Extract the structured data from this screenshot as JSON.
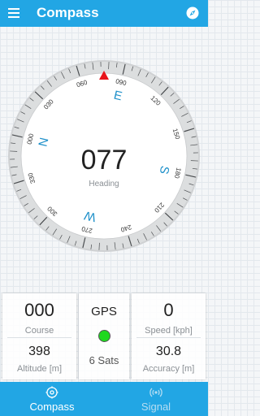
{
  "app_bar": {
    "title": "Compass",
    "menu_icon": "hamburger-menu-icon",
    "action_icon": "compass-needle-icon"
  },
  "compass": {
    "heading": "077",
    "heading_label": "Heading",
    "heading_degrees": 77,
    "cardinals": [
      "N",
      "E",
      "S",
      "W"
    ],
    "degree_labels": [
      "000",
      "030",
      "060",
      "090",
      "120",
      "150",
      "180",
      "210",
      "240",
      "270",
      "300",
      "330"
    ],
    "accent_color": "#1c8fc9",
    "marker_color": "#e8141b"
  },
  "panels": {
    "course_value": "000",
    "course_label": "Course",
    "altitude_value": "398",
    "altitude_label": "Altitude [m]",
    "gps_label": "GPS",
    "gps_status_color": "#1fd81f",
    "sats_text": "6 Sats",
    "speed_value": "0",
    "speed_label": "Speed [kph]",
    "accuracy_value": "30.8",
    "accuracy_label": "Accuracy [m]"
  },
  "bottom_nav": {
    "tabs": [
      {
        "label": "Compass",
        "icon": "compass-tab-icon",
        "active": true
      },
      {
        "label": "Signal",
        "icon": "signal-tab-icon",
        "active": false
      }
    ]
  },
  "colors": {
    "primary": "#22a6e4"
  }
}
